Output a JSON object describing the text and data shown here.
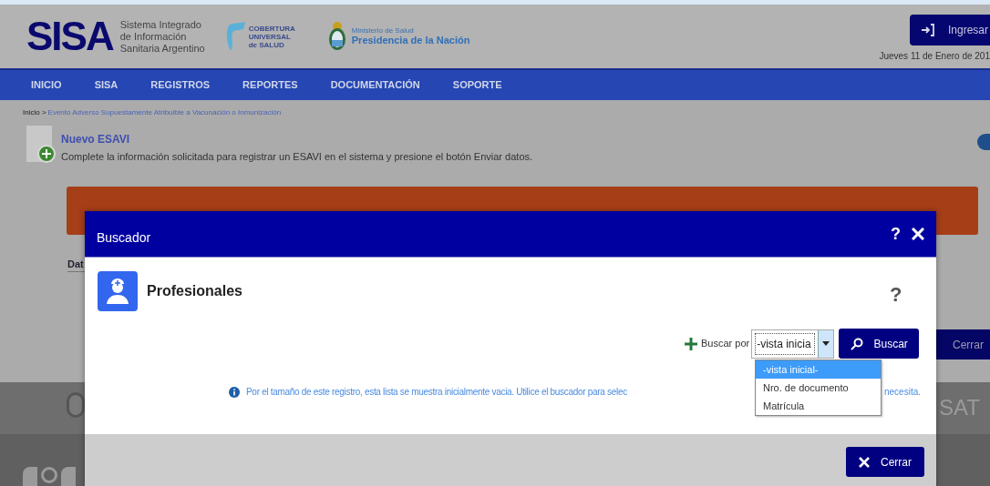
{
  "header": {
    "logo": {
      "text": "SISA",
      "subtitle": [
        "Sistema Integrado",
        "de Información",
        "Sanitaria Argentino"
      ]
    },
    "coverage_logo": [
      "COBERTURA",
      "UNIVERSAL",
      "de SALUD"
    ],
    "ministry": {
      "line1": "Ministerio de Salud",
      "line2": "Presidencia de la Nación"
    },
    "login_button": "Ingresar",
    "date": "Jueves 11 de Enero de 201"
  },
  "nav": {
    "items": [
      {
        "label": "INICIO"
      },
      {
        "label": "SISA"
      },
      {
        "label": "REGISTROS"
      },
      {
        "label": "REPORTES"
      },
      {
        "label": "DOCUMENTACIÓN"
      },
      {
        "label": "SOPORTE"
      }
    ]
  },
  "breadcrumb": {
    "root": "Inicio >",
    "current": "Evento Adverso Supuestamente Atribuible a Vacunación o Inmunización"
  },
  "page": {
    "title": "Nuevo ESAVI",
    "description": "Complete la información solicitada para registrar un ESAVI en el sistema y presione el botón Enviar datos.",
    "form_label": "Dat",
    "close_button": "Cerrar",
    "footer_text": "SAT"
  },
  "modal": {
    "title": "Buscador",
    "help": "?",
    "section": {
      "title": "Profesionales",
      "help": "?"
    },
    "search": {
      "label": "Buscar por",
      "select": {
        "value": "-vista inicia",
        "expanded": true,
        "options": [
          {
            "label": "-vista inicial-",
            "selected": true
          },
          {
            "label": "Nro. de documento",
            "selected": false
          },
          {
            "label": "Matrícula",
            "selected": false
          }
        ]
      },
      "button": "Buscar"
    },
    "info": [
      "Por el tamaño de este registro, esta lista se muestra inicialmente vacia. Utilice el buscador para selec",
      "necesita."
    ],
    "close_button": "Cerrar"
  }
}
